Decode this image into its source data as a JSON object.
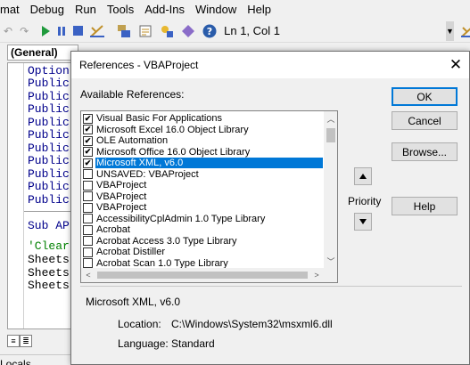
{
  "menubar": {
    "items": [
      "mat",
      "Debug",
      "Run",
      "Tools",
      "Add-Ins",
      "Window",
      "Help"
    ]
  },
  "toolbar": {
    "position": "Ln 1, Col 1",
    "icons": [
      "undo-icon",
      "redo-icon",
      "run-icon",
      "break-icon",
      "reset-icon",
      "design-mode-icon",
      "project-explorer-icon",
      "properties-icon",
      "object-browser-icon",
      "toolbox-icon",
      "help-icon"
    ]
  },
  "code_window": {
    "object_combo": "(General)",
    "lines": [
      {
        "text": "Option",
        "kind": "kw"
      },
      {
        "text": "Public",
        "kind": "kw"
      },
      {
        "text": "Public",
        "kind": "kw"
      },
      {
        "text": "Public",
        "kind": "kw"
      },
      {
        "text": "Public",
        "kind": "kw"
      },
      {
        "text": "Public",
        "kind": "kw"
      },
      {
        "text": "Public",
        "kind": "kw"
      },
      {
        "text": "Public",
        "kind": "kw"
      },
      {
        "text": "Public",
        "kind": "kw"
      },
      {
        "text": "Public",
        "kind": "kw"
      },
      {
        "text": "Public",
        "kind": "kw"
      },
      {
        "text": "Sub AP",
        "kind": "kw"
      },
      {
        "text": "'Clear",
        "kind": "cm"
      },
      {
        "text": "Sheets",
        "kind": "plain"
      },
      {
        "text": "Sheets",
        "kind": "plain"
      },
      {
        "text": "Sheets",
        "kind": "plain"
      }
    ],
    "locals_label": "Locals"
  },
  "dialog": {
    "title": "References - VBAProject",
    "available_label": "Available References:",
    "references": [
      {
        "label": "Visual Basic For Applications",
        "checked": true,
        "selected": false
      },
      {
        "label": "Microsoft Excel 16.0 Object Library",
        "checked": true,
        "selected": false
      },
      {
        "label": "OLE Automation",
        "checked": true,
        "selected": false
      },
      {
        "label": "Microsoft Office 16.0 Object Library",
        "checked": true,
        "selected": false
      },
      {
        "label": "Microsoft XML, v6.0",
        "checked": true,
        "selected": true
      },
      {
        "label": "UNSAVED: VBAProject",
        "checked": false,
        "selected": false
      },
      {
        "label": "VBAProject",
        "checked": false,
        "selected": false
      },
      {
        "label": "VBAProject",
        "checked": false,
        "selected": false
      },
      {
        "label": "VBAProject",
        "checked": false,
        "selected": false
      },
      {
        "label": "AccessibilityCplAdmin 1.0 Type Library",
        "checked": false,
        "selected": false
      },
      {
        "label": "Acrobat",
        "checked": false,
        "selected": false
      },
      {
        "label": "Acrobat Access 3.0 Type Library",
        "checked": false,
        "selected": false
      },
      {
        "label": "Acrobat Distiller",
        "checked": false,
        "selected": false
      },
      {
        "label": "Acrobat Scan 1.0 Type Library",
        "checked": false,
        "selected": false
      }
    ],
    "ok_label": "OK",
    "cancel_label": "Cancel",
    "browse_label": "Browse...",
    "help_label": "Help",
    "priority_label": "Priority",
    "info": {
      "title": "Microsoft XML, v6.0",
      "location_key": "Location:",
      "location_value": "C:\\Windows\\System32\\msxml6.dll",
      "language_key": "Language:",
      "language_value": "Standard"
    }
  }
}
